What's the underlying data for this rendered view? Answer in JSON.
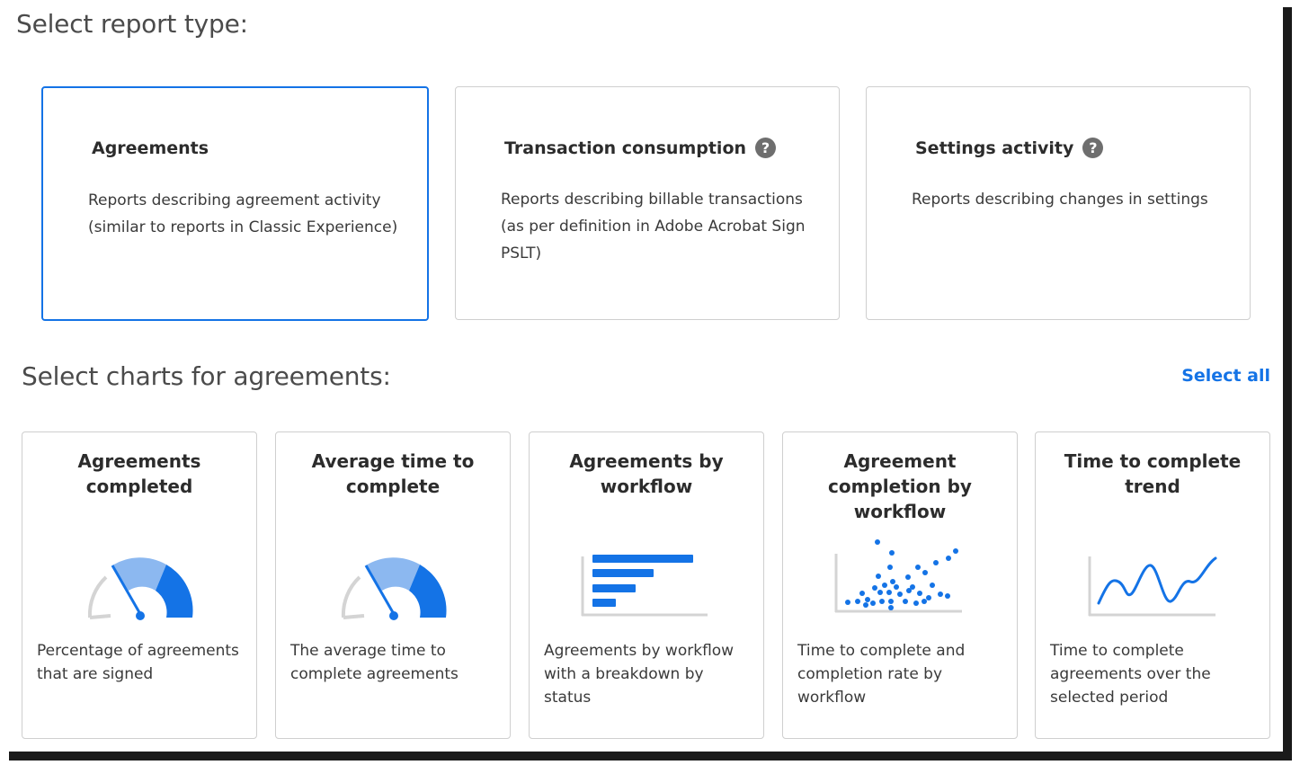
{
  "report_section": {
    "title": "Select report type:",
    "cards": [
      {
        "title": "Agreements",
        "description": "Reports describing agreement activity (similar to reports in Classic Experience)",
        "selected": true,
        "has_help": false
      },
      {
        "title": "Transaction consumption",
        "description": "Reports describing billable transactions (as per definition in Adobe Acrobat Sign PSLT)",
        "selected": false,
        "has_help": true
      },
      {
        "title": "Settings activity",
        "description": "Reports describing changes in settings",
        "selected": false,
        "has_help": true
      }
    ]
  },
  "charts_section": {
    "title": "Select charts for agreements:",
    "select_all_label": "Select all",
    "cards": [
      {
        "title": "Agreements completed",
        "description": "Percentage of agreements that are signed",
        "illustration": "gauge-icon"
      },
      {
        "title": "Average time to complete",
        "description": "The average time to complete agreements",
        "illustration": "gauge-icon"
      },
      {
        "title": "Agreements by workflow",
        "description": "Agreements by workflow with a breakdown by status",
        "illustration": "bar-chart-icon"
      },
      {
        "title": "Agreement completion by workflow",
        "description": "Time to complete and completion rate by workflow",
        "illustration": "scatter-plot-icon"
      },
      {
        "title": "Time to complete trend",
        "description": "Time to complete agreements over the selected period",
        "illustration": "line-chart-icon"
      }
    ]
  },
  "colors": {
    "accent": "#1473e6",
    "accent_light": "#8cb8f0",
    "gray_stroke": "#cfcfcf",
    "help_icon": "#6e6e6e",
    "text": "#2c2c2c"
  },
  "help_glyph": "?"
}
